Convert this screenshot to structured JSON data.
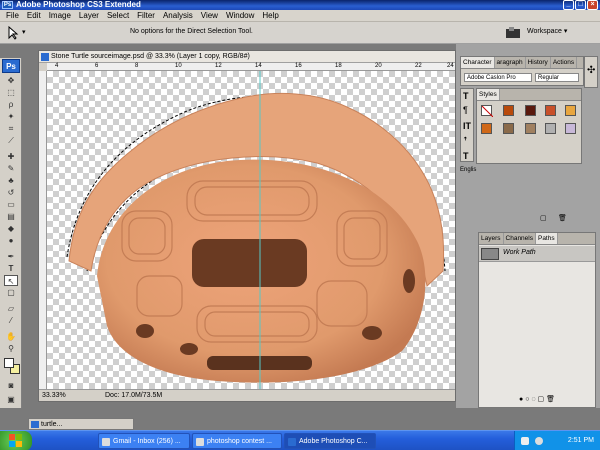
{
  "app": {
    "title": "Adobe Photoshop CS3 Extended",
    "ps_short": "Ps"
  },
  "menu": [
    "File",
    "Edit",
    "Image",
    "Layer",
    "Select",
    "Filter",
    "Analysis",
    "View",
    "Window",
    "Help"
  ],
  "options_bar": {
    "message": "No options for the Direct Selection Tool.",
    "workspace_label": "Workspace ▾"
  },
  "document": {
    "title": "Stone Turtle sourceimage.psd @ 33.3% (Layer 1 copy, RGB/8#)",
    "zoom": "33.33%",
    "doc_info": "Doc: 17.0M/73.5M",
    "ruler_labels": [
      "4",
      "6",
      "8",
      "10",
      "12",
      "14",
      "16",
      "18",
      "20",
      "22",
      "24"
    ]
  },
  "character_panel": {
    "tabs": [
      "Character",
      "aragraph",
      "History",
      "Actions"
    ],
    "font": "Adobe Caslon Pro",
    "style": "Regular",
    "language": "Englis"
  },
  "styles_panel": {
    "tab": "Styles"
  },
  "paths_panel": {
    "tabs": [
      "Layers",
      "Channels",
      "Paths"
    ],
    "items": [
      "Work Path"
    ]
  },
  "minimized_doc": {
    "title": "turtle..."
  },
  "taskbar": {
    "start": "start",
    "items": [
      {
        "label": "Gmail - Inbox (256) ..."
      },
      {
        "label": "photoshop contest ..."
      },
      {
        "label": "Adobe Photoshop C..."
      }
    ],
    "clock": "2:51 PM"
  },
  "colors": {
    "taskbar_blue": "#245edb",
    "turtle_clay": "#e09a6c"
  }
}
